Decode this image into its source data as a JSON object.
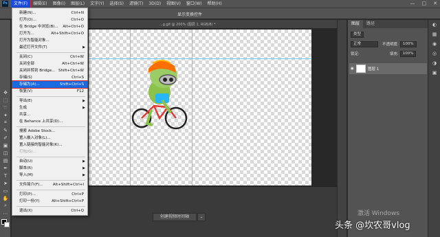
{
  "menubar": {
    "items": [
      "文件(F)",
      "编辑(E)",
      "图像(I)",
      "图层(L)",
      "文字(Y)",
      "选择(S)",
      "滤镜(T)",
      "3D(D)",
      "视图(V)",
      "窗口(W)",
      "帮助(H)"
    ],
    "window_controls": [
      "—",
      "□",
      "✕"
    ]
  },
  "options": {
    "label": "显示变换控件"
  },
  "document": {
    "tab_title": "...g.gif @ 200% (图层 1, RGB/8) *"
  },
  "file_menu": {
    "items": [
      {
        "label": "新建(N)...",
        "shortcut": "Ctrl+N"
      },
      {
        "label": "打开(O)...",
        "shortcut": "Ctrl+O"
      },
      {
        "label": "在 Bridge 中浏览(B)...",
        "shortcut": "Alt+Ctrl+O"
      },
      {
        "label": "打开为...",
        "shortcut": "Alt+Shift+Ctrl+O"
      },
      {
        "label": "打开为智能对象...",
        "shortcut": ""
      },
      {
        "label": "最近打开文件(T)",
        "shortcut": ""
      },
      {
        "label": "关闭(C)",
        "shortcut": "Ctrl+W"
      },
      {
        "label": "关闭全部",
        "shortcut": "Alt+Ctrl+W"
      },
      {
        "label": "关闭并转到 Bridge...",
        "shortcut": "Shift+Ctrl+W"
      },
      {
        "label": "存储(S)",
        "shortcut": "Ctrl+S"
      },
      {
        "label": "存储为(A)...",
        "shortcut": "Shift+Ctrl+S"
      },
      {
        "label": "恢复(V)",
        "shortcut": "F12"
      },
      {
        "label": "导出(E)",
        "shortcut": ""
      },
      {
        "label": "生成",
        "shortcut": ""
      },
      {
        "label": "共享...",
        "shortcut": ""
      },
      {
        "label": "在 Behance 上共享(D)...",
        "shortcut": ""
      },
      {
        "label": "搜索 Adobe Stock...",
        "shortcut": ""
      },
      {
        "label": "置入嵌入对象(L)...",
        "shortcut": ""
      },
      {
        "label": "置入链接的智能对象(K)...",
        "shortcut": ""
      },
      {
        "label": "打包(G)...",
        "shortcut": ""
      },
      {
        "label": "自动(U)",
        "shortcut": ""
      },
      {
        "label": "脚本(R)",
        "shortcut": ""
      },
      {
        "label": "导入(M)",
        "shortcut": ""
      },
      {
        "label": "文件简介(F)...",
        "shortcut": "Alt+Shift+Ctrl+I"
      },
      {
        "label": "打印(P)...",
        "shortcut": "Ctrl+P"
      },
      {
        "label": "打印一份(Y)",
        "shortcut": "Alt+Shift+Ctrl+P"
      },
      {
        "label": "退出(X)",
        "shortcut": "Ctrl+Q"
      }
    ]
  },
  "layers_panel": {
    "tabs": [
      "图层",
      "路径"
    ],
    "kind_label": "类型",
    "blend_mode": "正常",
    "opacity_label": "不透明度:",
    "opacity_value": "100%",
    "lock_label": "锁定:",
    "fill_label": "填充:",
    "fill_value": "100%",
    "layer_name": "图层 1"
  },
  "timeline": {
    "button_label": "创建视频时间轴"
  },
  "watermark": "激活 Windows",
  "brand": "头条 @坎农哥vlog"
}
